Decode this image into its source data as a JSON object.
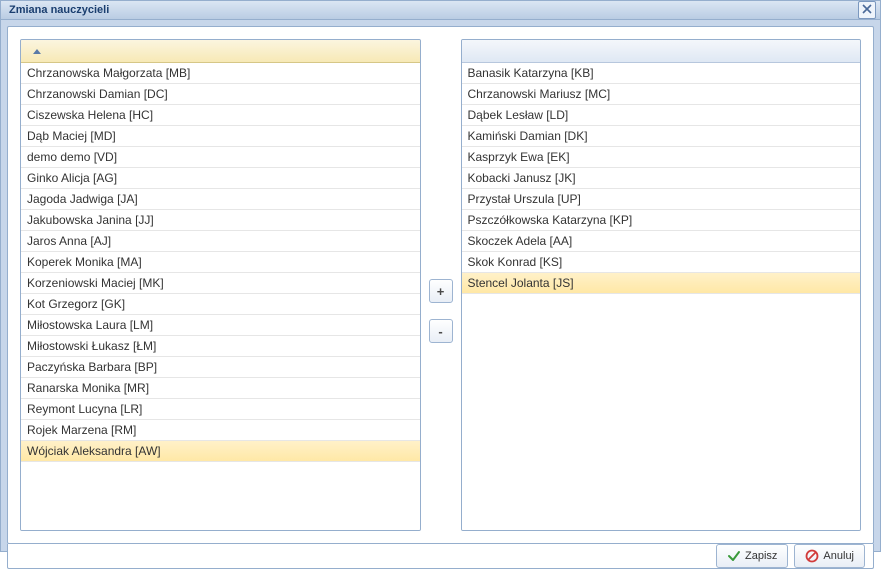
{
  "dialog": {
    "title": "Zmiana nauczycieli"
  },
  "left_list": {
    "sort": "asc",
    "items": [
      {
        "label": "Chrzanowska Małgorzata [MB]",
        "selected": false
      },
      {
        "label": "Chrzanowski Damian [DC]",
        "selected": false
      },
      {
        "label": "Ciszewska Helena [HC]",
        "selected": false
      },
      {
        "label": "Dąb Maciej [MD]",
        "selected": false
      },
      {
        "label": "demo demo [VD]",
        "selected": false
      },
      {
        "label": "Ginko Alicja [AG]",
        "selected": false
      },
      {
        "label": "Jagoda Jadwiga [JA]",
        "selected": false
      },
      {
        "label": "Jakubowska Janina [JJ]",
        "selected": false
      },
      {
        "label": "Jaros Anna [AJ]",
        "selected": false
      },
      {
        "label": "Koperek Monika [MA]",
        "selected": false
      },
      {
        "label": "Korzeniowski Maciej [MK]",
        "selected": false
      },
      {
        "label": "Kot Grzegorz [GK]",
        "selected": false
      },
      {
        "label": "Miłostowska Laura [LM]",
        "selected": false
      },
      {
        "label": "Miłostowski Łukasz [ŁM]",
        "selected": false
      },
      {
        "label": "Paczyńska Barbara [BP]",
        "selected": false
      },
      {
        "label": "Ranarska Monika [MR]",
        "selected": false
      },
      {
        "label": "Reymont Lucyna [LR]",
        "selected": false
      },
      {
        "label": "Rojek Marzena [RM]",
        "selected": false
      },
      {
        "label": "Wójciak Aleksandra [AW]",
        "selected": true
      }
    ]
  },
  "right_list": {
    "items": [
      {
        "label": "Banasik Katarzyna [KB]",
        "selected": false
      },
      {
        "label": "Chrzanowski Mariusz [MC]",
        "selected": false
      },
      {
        "label": "Dąbek Lesław [LD]",
        "selected": false
      },
      {
        "label": "Kamiński Damian [DK]",
        "selected": false
      },
      {
        "label": "Kasprzyk Ewa [EK]",
        "selected": false
      },
      {
        "label": "Kobacki Janusz [JK]",
        "selected": false
      },
      {
        "label": "Przystał Urszula [UP]",
        "selected": false
      },
      {
        "label": "Pszczółkowska Katarzyna [KP]",
        "selected": false
      },
      {
        "label": "Skoczek Adela [AA]",
        "selected": false
      },
      {
        "label": "Skok Konrad [KS]",
        "selected": false
      },
      {
        "label": "Stencel Jolanta [JS]",
        "selected": true
      }
    ]
  },
  "buttons": {
    "add": "+",
    "remove": "-",
    "save": "Zapisz",
    "cancel": "Anuluj"
  }
}
